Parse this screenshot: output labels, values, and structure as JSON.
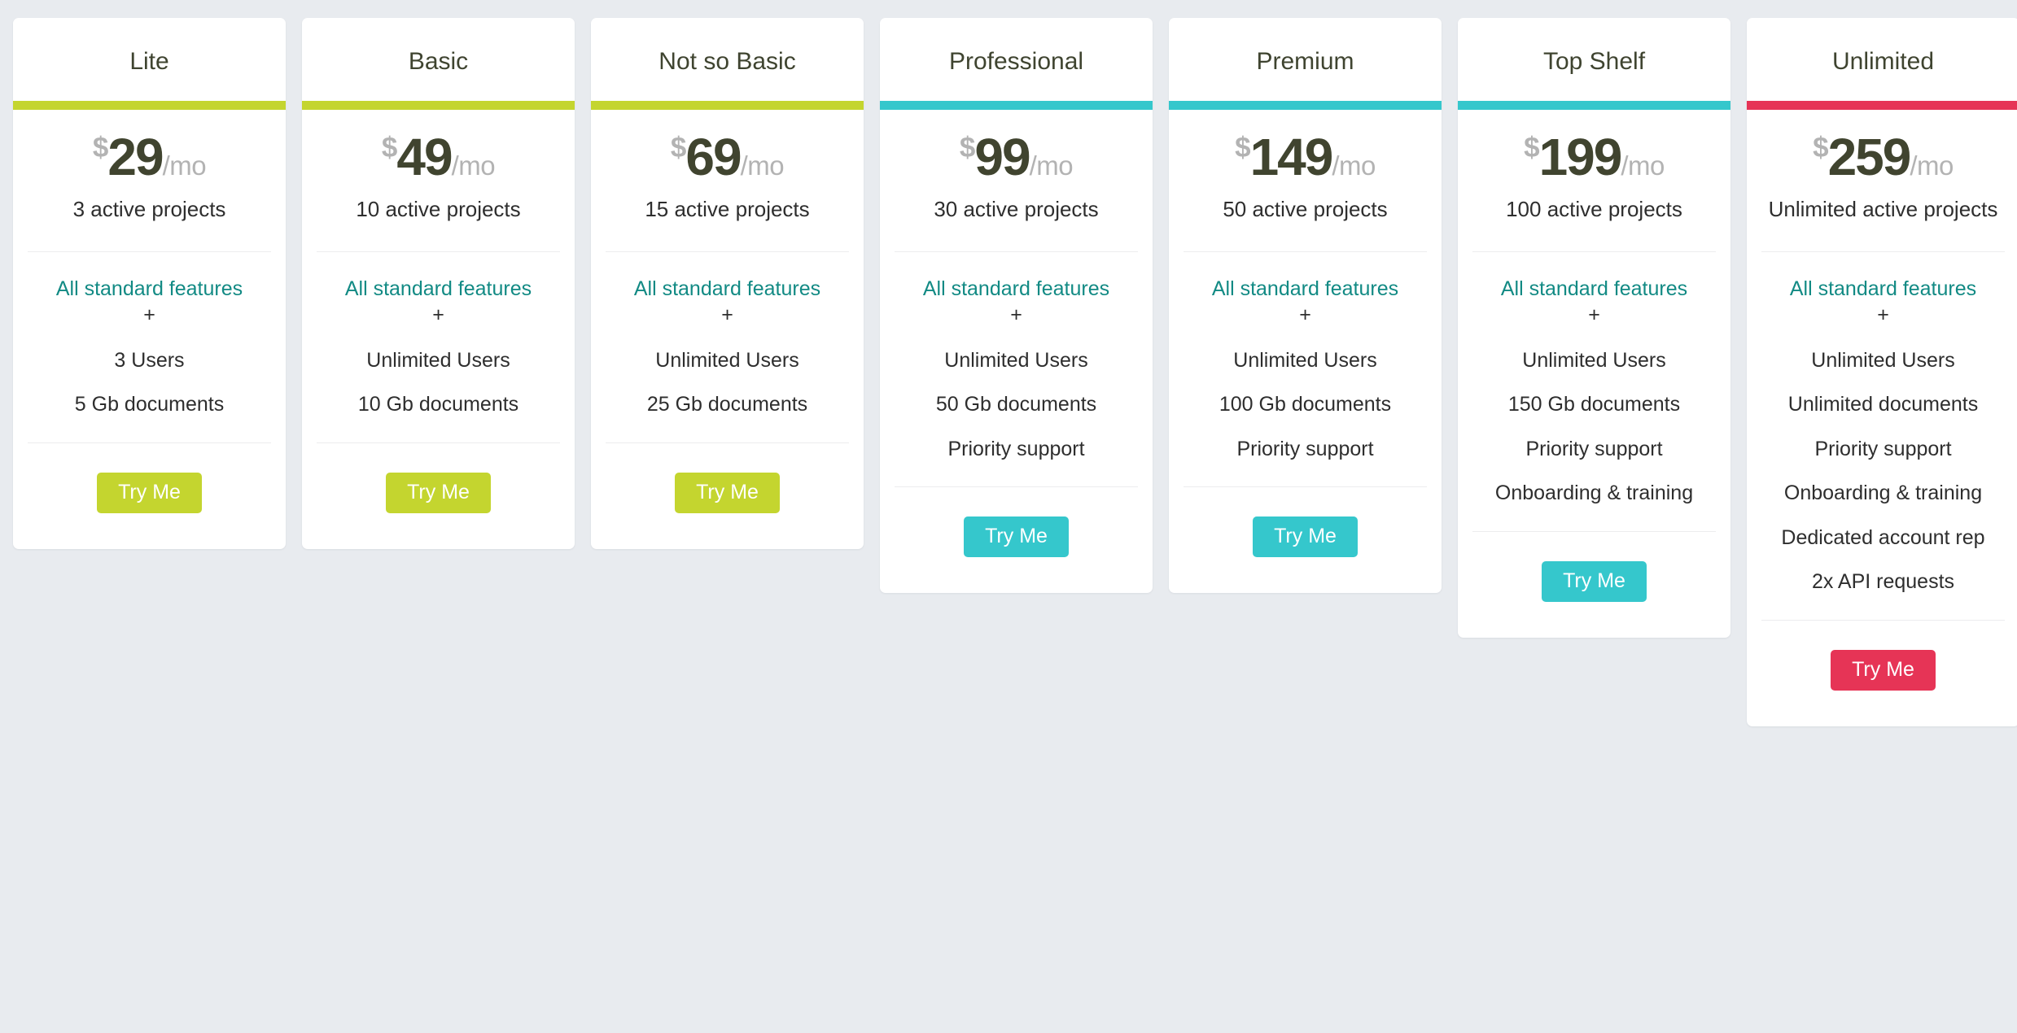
{
  "theme": {
    "page_background": "#e8ebef",
    "card_background": "#ffffff",
    "accent_lime": "#c4d52f",
    "accent_teal": "#35c7cc",
    "accent_crimson": "#e63456",
    "feature_head_color": "#128a84",
    "price_color": "#40442f",
    "muted_color": "#b3b3b3"
  },
  "plans": [
    {
      "name": "Lite",
      "accent": "#c4d52f",
      "currency": "$",
      "amount": "29",
      "period": "/mo",
      "projects": "3 active projects",
      "features_head": "All standard features",
      "plus": "+",
      "features": [
        "3 Users",
        "5 Gb documents"
      ],
      "cta_label": "Try Me",
      "cta_color": "#c4d52f"
    },
    {
      "name": "Basic",
      "accent": "#c4d52f",
      "currency": "$",
      "amount": "49",
      "period": "/mo",
      "projects": "10 active projects",
      "features_head": "All standard features",
      "plus": "+",
      "features": [
        "Unlimited Users",
        "10 Gb documents"
      ],
      "cta_label": "Try Me",
      "cta_color": "#c4d52f"
    },
    {
      "name": "Not so Basic",
      "accent": "#c4d52f",
      "currency": "$",
      "amount": "69",
      "period": "/mo",
      "projects": "15 active projects",
      "features_head": "All standard features",
      "plus": "+",
      "features": [
        "Unlimited Users",
        "25 Gb documents"
      ],
      "cta_label": "Try Me",
      "cta_color": "#c4d52f"
    },
    {
      "name": "Professional",
      "accent": "#35c7cc",
      "currency": "$",
      "amount": "99",
      "period": "/mo",
      "projects": "30 active projects",
      "features_head": "All standard features",
      "plus": "+",
      "features": [
        "Unlimited Users",
        "50 Gb documents",
        "Priority support"
      ],
      "cta_label": "Try Me",
      "cta_color": "#35c7cc"
    },
    {
      "name": "Premium",
      "accent": "#35c7cc",
      "currency": "$",
      "amount": "149",
      "period": "/mo",
      "projects": "50 active projects",
      "features_head": "All standard features",
      "plus": "+",
      "features": [
        "Unlimited Users",
        "100 Gb documents",
        "Priority support"
      ],
      "cta_label": "Try Me",
      "cta_color": "#35c7cc"
    },
    {
      "name": "Top Shelf",
      "accent": "#35c7cc",
      "currency": "$",
      "amount": "199",
      "period": "/mo",
      "projects": "100 active projects",
      "features_head": "All standard features",
      "plus": "+",
      "features": [
        "Unlimited Users",
        "150 Gb documents",
        "Priority support",
        "Onboarding & training"
      ],
      "cta_label": "Try Me",
      "cta_color": "#35c7cc"
    },
    {
      "name": "Unlimited",
      "accent": "#e63456",
      "currency": "$",
      "amount": "259",
      "period": "/mo",
      "projects": "Unlimited active projects",
      "features_head": "All standard features",
      "plus": "+",
      "features": [
        "Unlimited Users",
        "Unlimited documents",
        "Priority support",
        "Onboarding & training",
        "Dedicated account rep",
        "2x API requests"
      ],
      "cta_label": "Try Me",
      "cta_color": "#e63456"
    }
  ]
}
